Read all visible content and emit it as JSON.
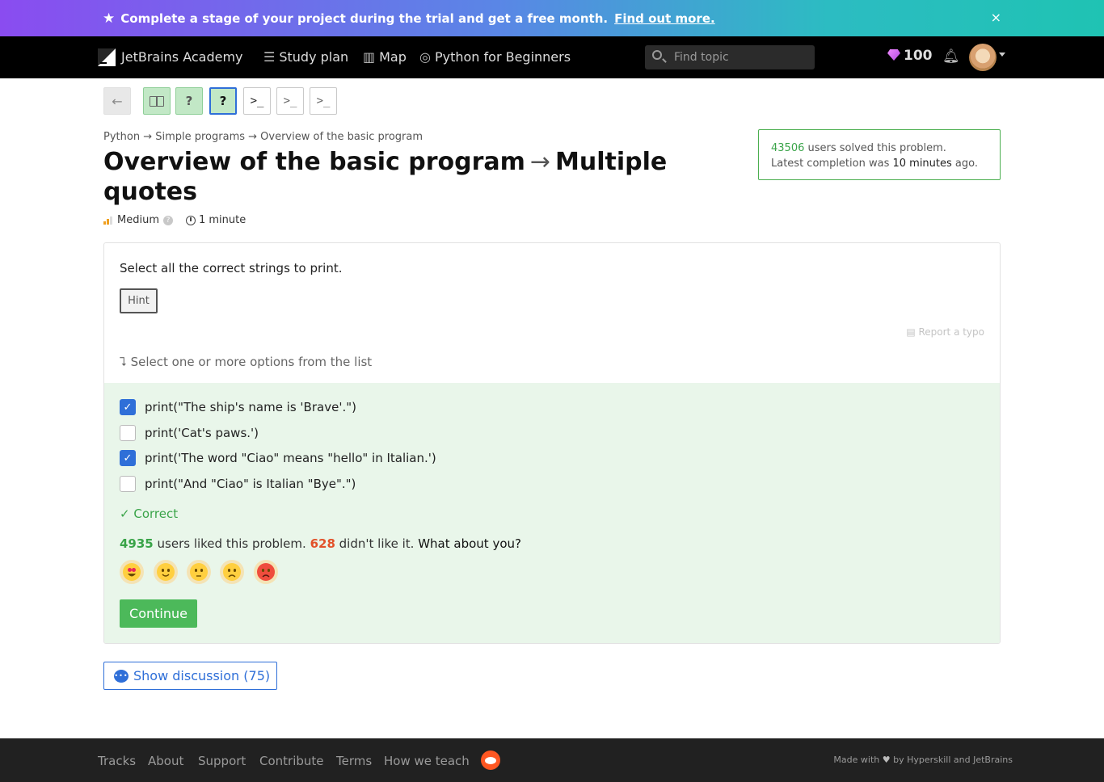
{
  "promo": {
    "message": "Complete a stage of your project during the trial and get a free month.",
    "link": "Find out more.",
    "close": "×"
  },
  "nav": {
    "brand": "JetBrains Academy",
    "study_plan": "Study plan",
    "map": "Map",
    "track": "Python for Beginners",
    "search_placeholder": "Find topic",
    "gems": "100"
  },
  "steps": [
    {
      "kind": "back",
      "glyph": "←"
    },
    {
      "kind": "theory",
      "glyph": "▯"
    },
    {
      "kind": "quiz-done",
      "glyph": "?"
    },
    {
      "kind": "quiz-current",
      "glyph": "?"
    },
    {
      "kind": "code",
      "glyph": ">_"
    },
    {
      "kind": "code",
      "glyph": ">_"
    },
    {
      "kind": "code",
      "glyph": ">_"
    }
  ],
  "breadcrumb": "Python → Simple programs → Overview of the basic program",
  "title": {
    "topic": "Overview of the basic program",
    "arrow": "→",
    "problem": "Multiple quotes"
  },
  "meta": {
    "difficulty": "Medium",
    "difficulty_level": 2,
    "duration": "1 minute"
  },
  "stats": {
    "solved_count": "43506",
    "solved_suffix": " users solved this problem.",
    "latest_prefix": "Latest completion was ",
    "latest_time": "10 minutes",
    "latest_suffix": " ago."
  },
  "task": {
    "prompt": "Select all the correct strings to print.",
    "hint": "Hint",
    "report": "Report a typo",
    "select_hint": "Select one or more options from the list"
  },
  "options": [
    {
      "label": "print(\"The ship's name is 'Brave'.\")",
      "checked": true
    },
    {
      "label": "print('Cat's paws.')",
      "checked": false
    },
    {
      "label": "print('The word \"Ciao\" means \"hello\" in Italian.')",
      "checked": true
    },
    {
      "label": "print(\"And \"Ciao\" is Italian \"Bye\".\")",
      "checked": false
    }
  ],
  "result": {
    "correct": "Correct",
    "likes": "4935",
    "likes_text": " users liked this problem. ",
    "dislikes": "628",
    "dislikes_text": " didn't like it. ",
    "question": "What about you?",
    "continue": "Continue"
  },
  "emojis": [
    "love",
    "happy",
    "neutral",
    "sad",
    "angry"
  ],
  "discussion": "Show discussion (75)",
  "footer": {
    "links": [
      "Tracks",
      "About",
      "Support",
      "Contribute",
      "Terms",
      "How we teach"
    ],
    "made_prefix": "Made with ",
    "made_suffix": " by Hyperskill and JetBrains"
  },
  "colors": {
    "accent_blue": "#2f6fd8",
    "success_green": "#4cb95a",
    "dislike_red": "#e2522a"
  }
}
